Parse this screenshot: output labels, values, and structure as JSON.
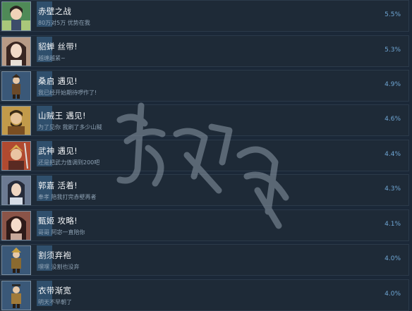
{
  "achievements": [
    {
      "title": "赤壁之战",
      "desc": "80万对5万 优势在我",
      "percent": "5.5%",
      "palette": "#2f6a47",
      "icon": "portrait-chibi-icon"
    },
    {
      "title": "貂蝉 丝带!",
      "desc": "越缠越紧~",
      "percent": "5.3%",
      "palette": "#8a6c5c",
      "icon": "portrait-diaochan-icon"
    },
    {
      "title": "桑启 遇见!",
      "desc": "我已经开始期待啰作了!",
      "percent": "4.9%",
      "palette": "#34506e",
      "icon": "portrait-sangqi-icon"
    },
    {
      "title": "山贼王 遇见!",
      "desc": "为了见你 我刷了多少山贼",
      "percent": "4.6%",
      "palette": "#8a6c2c",
      "icon": "portrait-bandit-king-icon"
    },
    {
      "title": "武神 遇见!",
      "desc": "还是把武力值调到200吧",
      "percent": "4.4%",
      "palette": "#9b3a28",
      "icon": "portrait-wushen-icon"
    },
    {
      "title": "郭嘉 活着!",
      "desc": "奉孝 陪我打完赤壁再者",
      "percent": "4.3%",
      "palette": "#4d5e7a",
      "icon": "portrait-guojia-icon"
    },
    {
      "title": "甄姬 攻略!",
      "desc": "哥哥 阿宓一直陪你",
      "percent": "4.1%",
      "palette": "#6b3c36",
      "icon": "portrait-zhenji-icon"
    },
    {
      "title": "割须弃袍",
      "desc": "嘿嘿 没割也没弃",
      "percent": "4.0%",
      "palette": "#34506e",
      "icon": "portrait-caocao-icon"
    },
    {
      "title": "衣带渐宽",
      "desc": "明天不早朝了",
      "percent": "4.0%",
      "palette": "#34506e",
      "icon": "portrait-emperor-icon"
    }
  ],
  "watermark": {
    "icon": "watermark-logo-icon"
  }
}
